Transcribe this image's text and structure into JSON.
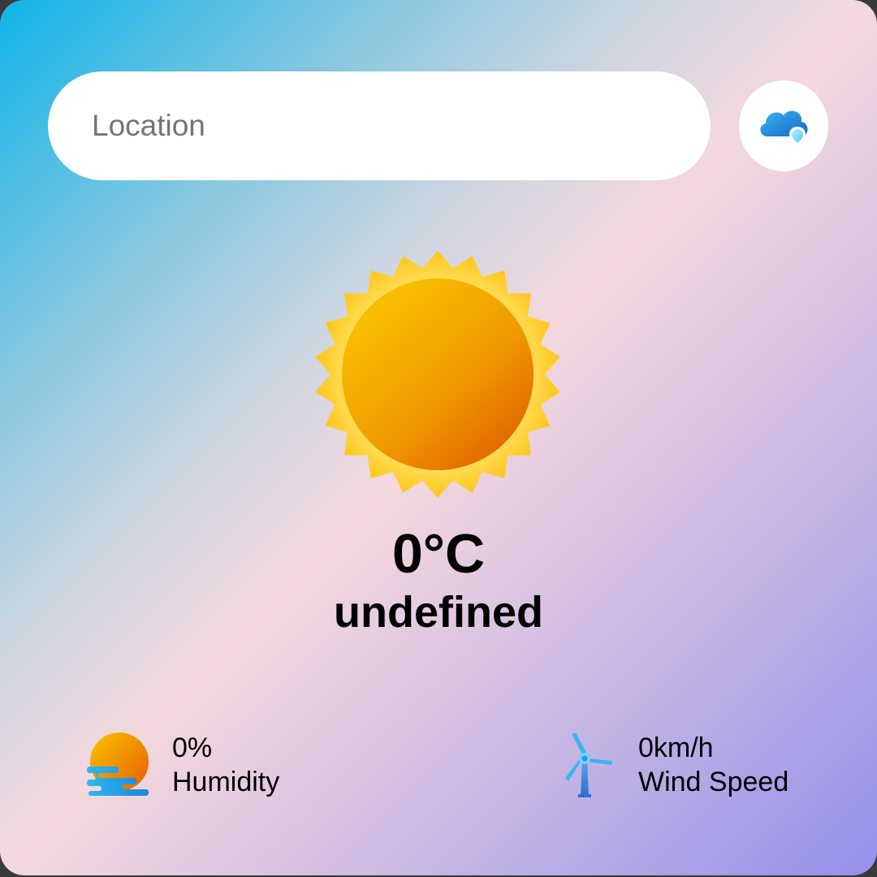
{
  "search": {
    "placeholder": "Location",
    "value": "",
    "button_icon": "cloud-icon"
  },
  "current": {
    "icon": "sun-icon",
    "temperature": "0°C",
    "condition": "undefined"
  },
  "details": {
    "humidity": {
      "value": "0%",
      "label": "Humidity",
      "icon": "humidity-icon"
    },
    "wind": {
      "value": "0km/h",
      "label": "Wind Speed",
      "icon": "wind-turbine-icon"
    }
  },
  "colors": {
    "gradient_start": "#0fb4e8",
    "gradient_mid": "#f4d8de",
    "gradient_end": "#948feb"
  }
}
